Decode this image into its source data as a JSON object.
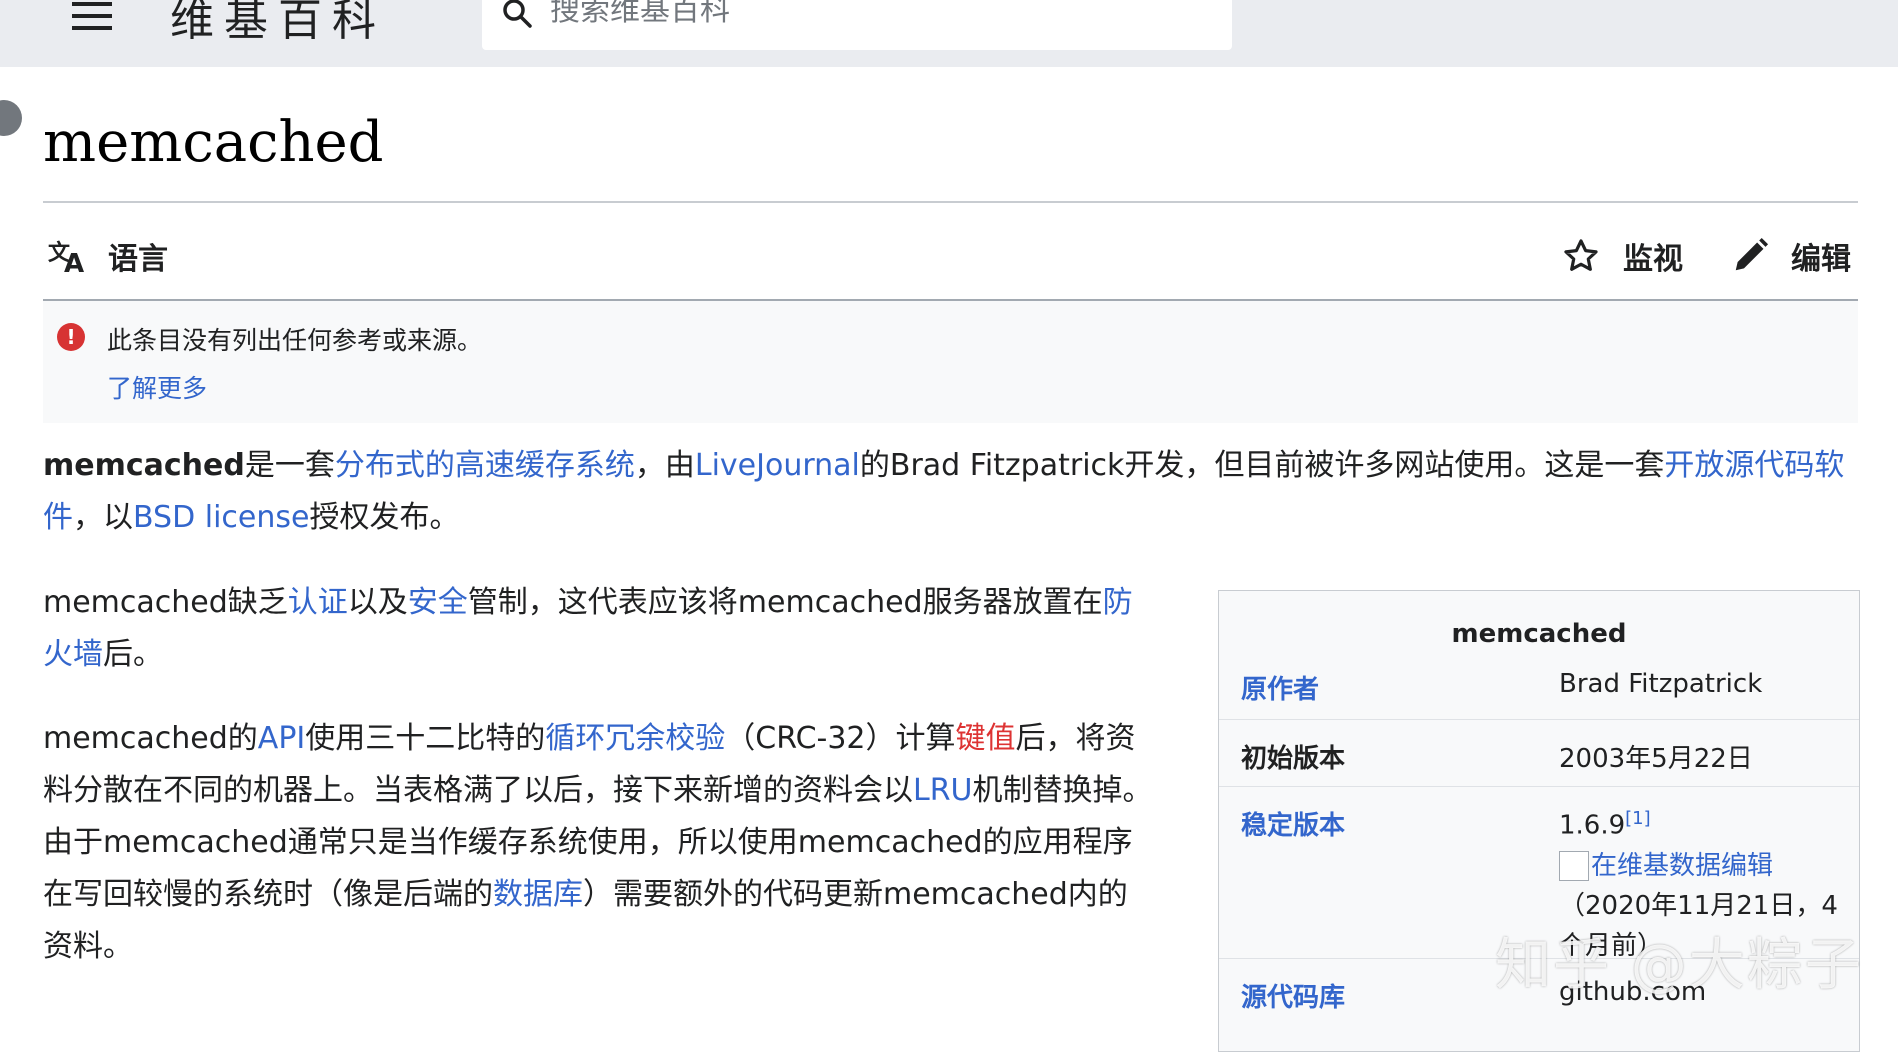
{
  "header": {
    "site_name": "维基百科",
    "search_placeholder": "搜索维基百科"
  },
  "page": {
    "title": "memcached"
  },
  "tools": {
    "language_label": "语言",
    "watch_label": "监视",
    "edit_label": "编辑"
  },
  "notice": {
    "icon_text": "!",
    "message": "此条目没有列出任何参考或来源。",
    "learn_more": "了解更多"
  },
  "article": {
    "p1": {
      "bold_term": "memcached",
      "t1": "是一套",
      "l1": "分布式的高速缓存系统",
      "t2": "，由",
      "l2": "LiveJournal",
      "t3": "的Brad Fitzpatrick开发，但目前被许多网站使用。这是一套",
      "l3": "开放源代码软件",
      "t4": "，以",
      "l4": "BSD license",
      "t5": "授权发布。"
    },
    "p2": {
      "t1": "memcached缺乏",
      "l1": "认证",
      "t2": "以及",
      "l2": "安全",
      "t3": "管制，这代表应该将memcached服务器放置在",
      "l3": "防火墙",
      "t4": "后。"
    },
    "p3": {
      "t1": "memcached的",
      "l1": "API",
      "t2": "使用三十二比特的",
      "l2": "循环冗余校验",
      "t3": "（CRC-32）计算",
      "l3": "键值",
      "t4": "后，将资料分散在不同的机器上。当表格满了以后，接下来新增的资料会以",
      "l4": "LRU",
      "t5": "机制替换掉。由于memcached通常只是当作缓存系统使用，所以使用memcached的应用程序在写回较慢的系统时（像是后端的",
      "l5": "数据库",
      "t6": "）需要额外的代码更新memcached内的资料。"
    }
  },
  "infobox": {
    "title": "memcached",
    "rows": [
      {
        "label": "原作者",
        "value": "Brad Fitzpatrick"
      },
      {
        "label": "初始版本",
        "value": "2003年5月22日"
      },
      {
        "label": "稳定版本",
        "value": "1.6.9",
        "ref": "[1]",
        "wikidata_link": "在维基数据编辑",
        "date_line1": "（2020年11月21日，4",
        "date_line2": "个月前）"
      },
      {
        "label": "源代码库",
        "value": "github.com"
      }
    ]
  },
  "watermark": "知乎 @大粽子",
  "colors": {
    "link": "#3366cc",
    "redlink": "#d33",
    "header_bg": "#eaecf0",
    "notice_icon": "#d73333"
  }
}
